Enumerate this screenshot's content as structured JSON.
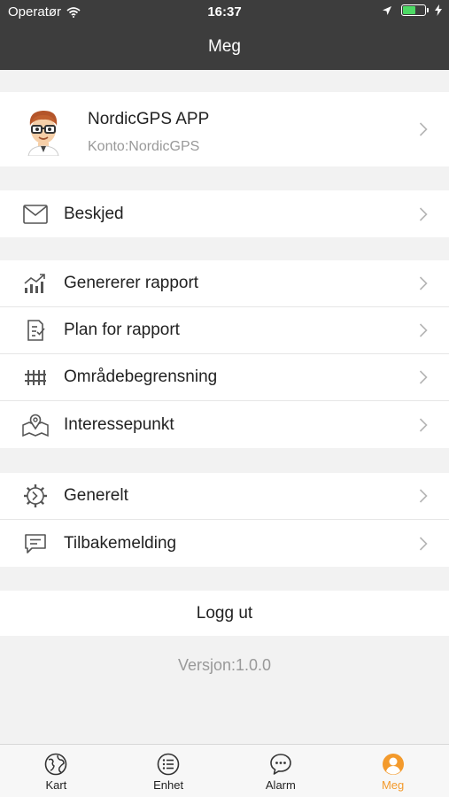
{
  "status": {
    "carrier": "Operatør",
    "time": "16:37"
  },
  "header": {
    "title": "Meg"
  },
  "profile": {
    "name": "NordicGPS APP",
    "account": "Konto:NordicGPS"
  },
  "menu": {
    "message": {
      "label": "Beskjed",
      "icon": "envelope-icon"
    },
    "group2": [
      {
        "label": "Genererer rapport",
        "icon": "chart-icon"
      },
      {
        "label": "Plan for rapport",
        "icon": "clipboard-check-icon"
      },
      {
        "label": "Områdebegrensning",
        "icon": "fence-icon"
      },
      {
        "label": "Interessepunkt",
        "icon": "map-pin-icon"
      }
    ],
    "group3": [
      {
        "label": "Generelt",
        "icon": "gear-icon"
      },
      {
        "label": "Tilbakemelding",
        "icon": "chat-icon"
      }
    ]
  },
  "logout": "Logg ut",
  "version": "Versjon:1.0.0",
  "tabs": [
    {
      "label": "Kart",
      "icon": "globe-icon"
    },
    {
      "label": "Enhet",
      "icon": "list-icon"
    },
    {
      "label": "Alarm",
      "icon": "chat-bubble-icon"
    },
    {
      "label": "Meg",
      "icon": "person-icon"
    }
  ],
  "colors": {
    "header": "#3d3d3d",
    "accent": "#f39a2c",
    "background": "#f2f2f2"
  }
}
